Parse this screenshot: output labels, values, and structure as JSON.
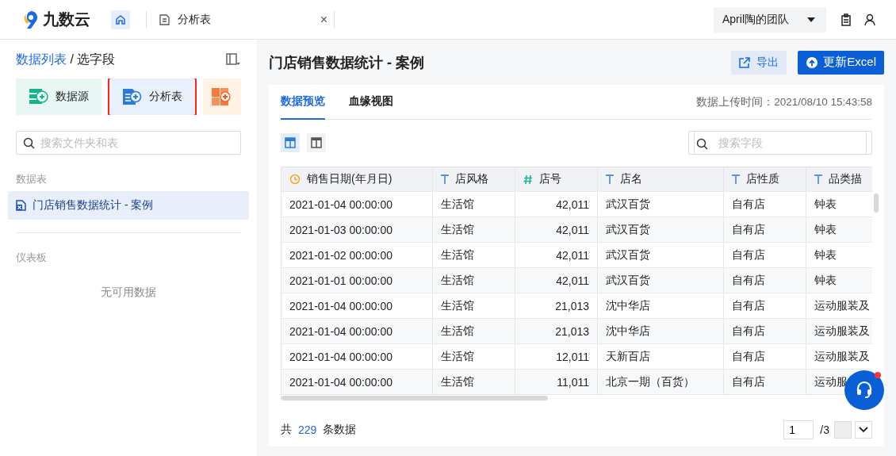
{
  "header": {
    "logo": "九数云",
    "tabs": [
      {
        "kind": "home",
        "selected": true
      },
      {
        "kind": "doc",
        "label": "分析表",
        "close": "×",
        "selected": false
      }
    ],
    "team": "April陶的团队"
  },
  "sidebar": {
    "breadcrumb_link": "数据列表",
    "breadcrumb_current": " / 选字段",
    "tiles": [
      {
        "kind": "source",
        "label": "数据源",
        "outlined": false
      },
      {
        "kind": "analysis",
        "label": "分析表",
        "outlined": true
      },
      {
        "kind": "dashboard",
        "outlined": false
      }
    ],
    "search": {
      "placeholder": "搜索文件夹和表"
    },
    "sections": [
      {
        "title": "数据表",
        "items": [
          {
            "label": "门店销售数据统计 - 案例",
            "selected": true
          }
        ]
      },
      {
        "title": "仪表板",
        "empty": "无可用数据"
      }
    ]
  },
  "main": {
    "title": "门店销售数据统计 - 案例",
    "export_button": "导出",
    "update_button": "更新Excel",
    "tabs": [
      {
        "label": "数据预览",
        "selected": true
      },
      {
        "label": "血缘视图",
        "selected": false
      }
    ],
    "upload_time": "数据上传时间：2021/08/10 15:43:58",
    "views": [
      {
        "selected": true
      },
      {
        "selected": false
      }
    ],
    "field_search": {
      "placeholder": "搜索字段"
    },
    "columns": [
      {
        "label": "销售日期(年月日)",
        "kind": "date"
      },
      {
        "label": "店风格",
        "kind": "text"
      },
      {
        "label": "店号",
        "kind": "number"
      },
      {
        "label": "店名",
        "kind": "text"
      },
      {
        "label": "店性质",
        "kind": "text"
      },
      {
        "label": "品类描",
        "kind": "text"
      }
    ],
    "rows": [
      [
        "2021-01-04 00:00:00",
        "生活馆",
        "42,011",
        "武汉百货",
        "自有店",
        "钟表"
      ],
      [
        "2021-01-03 00:00:00",
        "生活馆",
        "42,011",
        "武汉百货",
        "自有店",
        "钟表"
      ],
      [
        "2021-01-02 00:00:00",
        "生活馆",
        "42,011",
        "武汉百货",
        "自有店",
        "钟表"
      ],
      [
        "2021-01-01 00:00:00",
        "生活馆",
        "42,011",
        "武汉百货",
        "自有店",
        "钟表"
      ],
      [
        "2021-01-04 00:00:00",
        "生活馆",
        "21,013",
        "沈中华店",
        "自有店",
        "运动服装及"
      ],
      [
        "2021-01-04 00:00:00",
        "生活馆",
        "21,013",
        "沈中华店",
        "自有店",
        "运动服装及"
      ],
      [
        "2021-01-04 00:00:00",
        "生活馆",
        "12,011",
        "天新百店",
        "自有店",
        "运动服装及"
      ],
      [
        "2021-01-04 00:00:00",
        "生活馆",
        "11,011",
        "北京一期（百货）",
        "自有店",
        "运动服"
      ]
    ],
    "footer": {
      "prefix": "共",
      "count": "229",
      "suffix": "条数据",
      "page": "1",
      "pages": "/3"
    }
  }
}
